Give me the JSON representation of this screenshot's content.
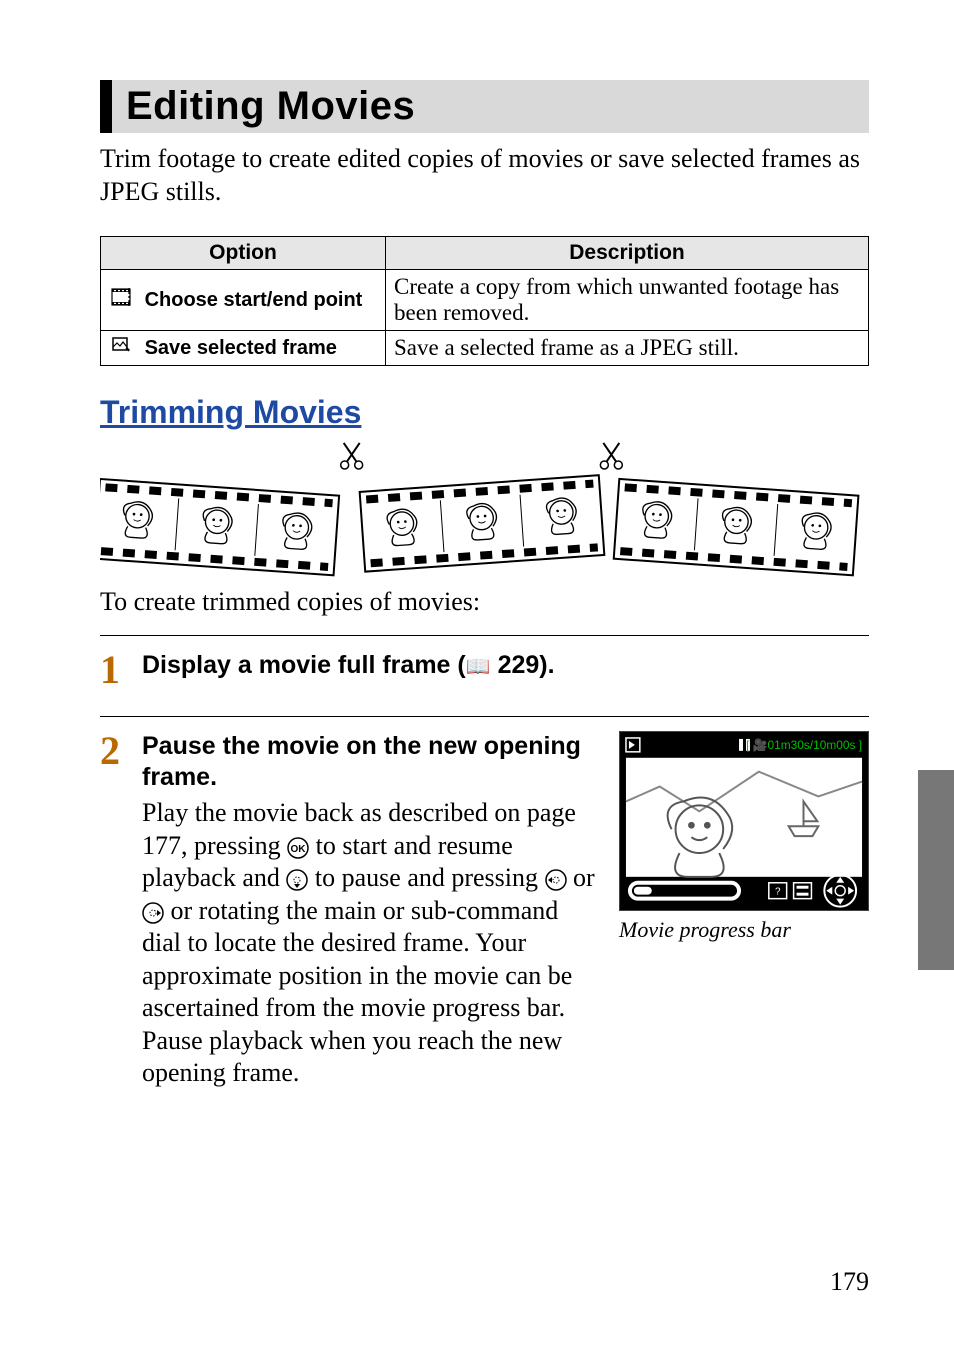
{
  "section": {
    "title": "Editing Movies"
  },
  "intro": "Trim footage to create edited copies of movies or save selected frames as JPEG stills.",
  "table": {
    "headers": {
      "option": "Option",
      "description": "Description"
    },
    "rows": [
      {
        "icon": "trim-icon",
        "glyph": "▥",
        "label": "Choose start/end point",
        "desc": "Create a copy from which unwanted footage has been removed."
      },
      {
        "icon": "save-frame-icon",
        "glyph": "✧",
        "label": "Save selected frame",
        "desc": "Save a selected frame as a JPEG still."
      }
    ]
  },
  "subsection": {
    "title": "Trimming Movies"
  },
  "lead": "To create trimmed copies of movies:",
  "steps": {
    "s1": {
      "num": "1",
      "head_pre": "Display a movie full frame (",
      "head_ref": "0",
      "head_page": " 229).",
      "head_post": ""
    },
    "s2": {
      "num": "2",
      "head": "Pause the movie on the new opening frame.",
      "p1a": "Play the movie back as described on page 177, pressing ",
      "ok_glyph": "J",
      "p1b": " to start and resume playback and ",
      "down_glyph": "3",
      "p1c": " to pause and pressing ",
      "left_glyph": "4",
      "p1d": " or ",
      "right_glyph": "2",
      "p1e": " or rotating the main or sub-command dial to locate the desired frame.  Your approximate position in the movie can be ascertained from the movie progress bar.  Pause playback when you reach the new opening frame.",
      "lcd_time": "01m30s/10m00s",
      "lcd_caption": "Movie progress bar"
    }
  },
  "page_number": "179"
}
